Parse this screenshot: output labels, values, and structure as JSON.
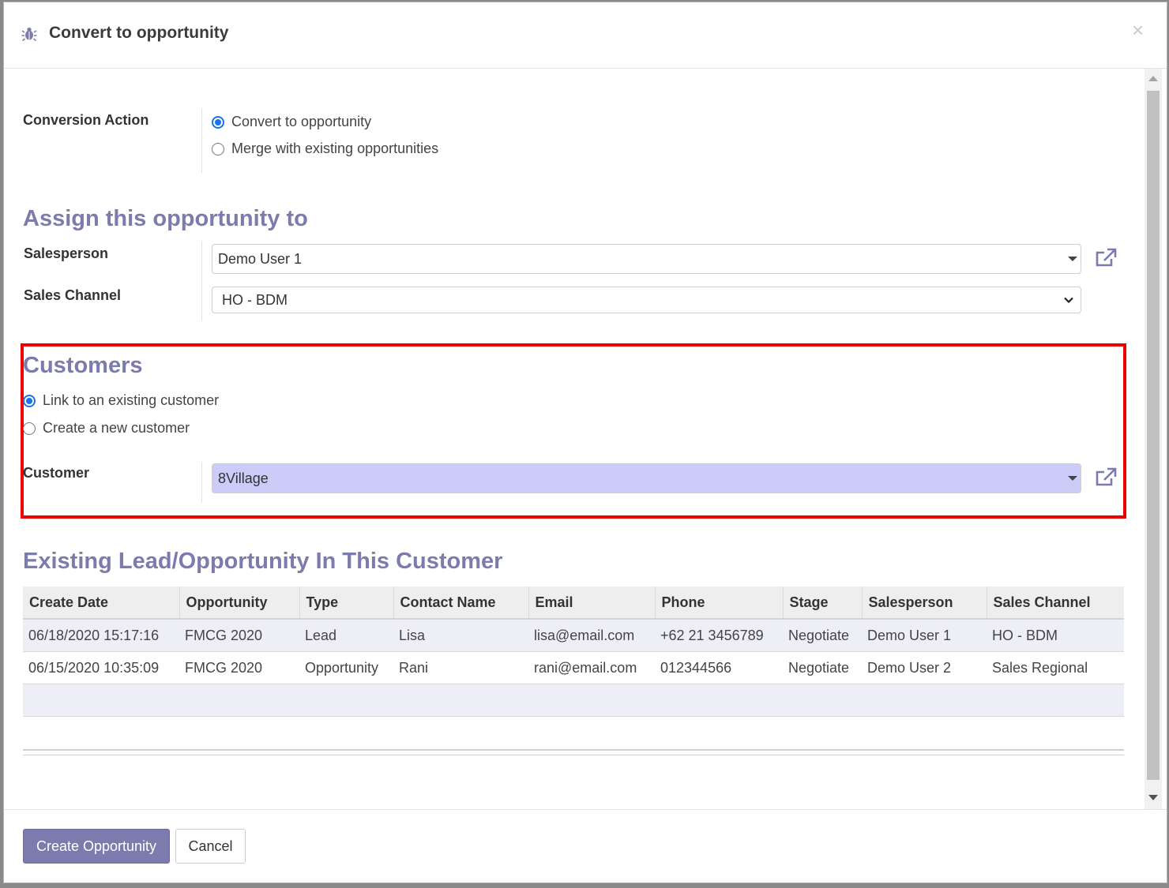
{
  "dialog": {
    "title": "Convert to opportunity",
    "icon": "bug-icon",
    "close_symbol": "×"
  },
  "conversion": {
    "label": "Conversion Action",
    "options": [
      "Convert to opportunity",
      "Merge with existing opportunities"
    ],
    "selected": "Convert to opportunity"
  },
  "assign": {
    "title": "Assign this opportunity to",
    "salesperson_label": "Salesperson",
    "salesperson_value": "Demo User 1",
    "channel_label": "Sales Channel",
    "channel_value": "HO - BDM"
  },
  "customers": {
    "title": "Customers",
    "options": [
      "Link to an existing customer",
      "Create a new customer"
    ],
    "selected": "Link to an existing customer",
    "customer_label": "Customer",
    "customer_value": "8Village"
  },
  "existing": {
    "title": "Existing Lead/Opportunity In This Customer",
    "columns": [
      "Create Date",
      "Opportunity",
      "Type",
      "Contact Name",
      "Email",
      "Phone",
      "Stage",
      "Salesperson",
      "Sales Channel"
    ],
    "rows": [
      [
        "06/18/2020 15:17:16",
        "FMCG 2020",
        "Lead",
        "Lisa",
        "lisa@email.com",
        "+62 21 3456789",
        "Negotiate",
        "Demo User 1",
        "HO - BDM"
      ],
      [
        "06/15/2020 10:35:09",
        "FMCG 2020",
        "Opportunity",
        "Rani",
        "rani@email.com",
        "012344566",
        "Negotiate",
        "Demo User 2",
        "Sales Regional"
      ]
    ]
  },
  "footer": {
    "create_label": "Create Opportunity",
    "cancel_label": "Cancel"
  },
  "colors": {
    "accent": "#7c7bad",
    "highlight_field": "#ccccf8",
    "annotation_box": "#ec0000",
    "radio_checked": "#1a73e8"
  }
}
